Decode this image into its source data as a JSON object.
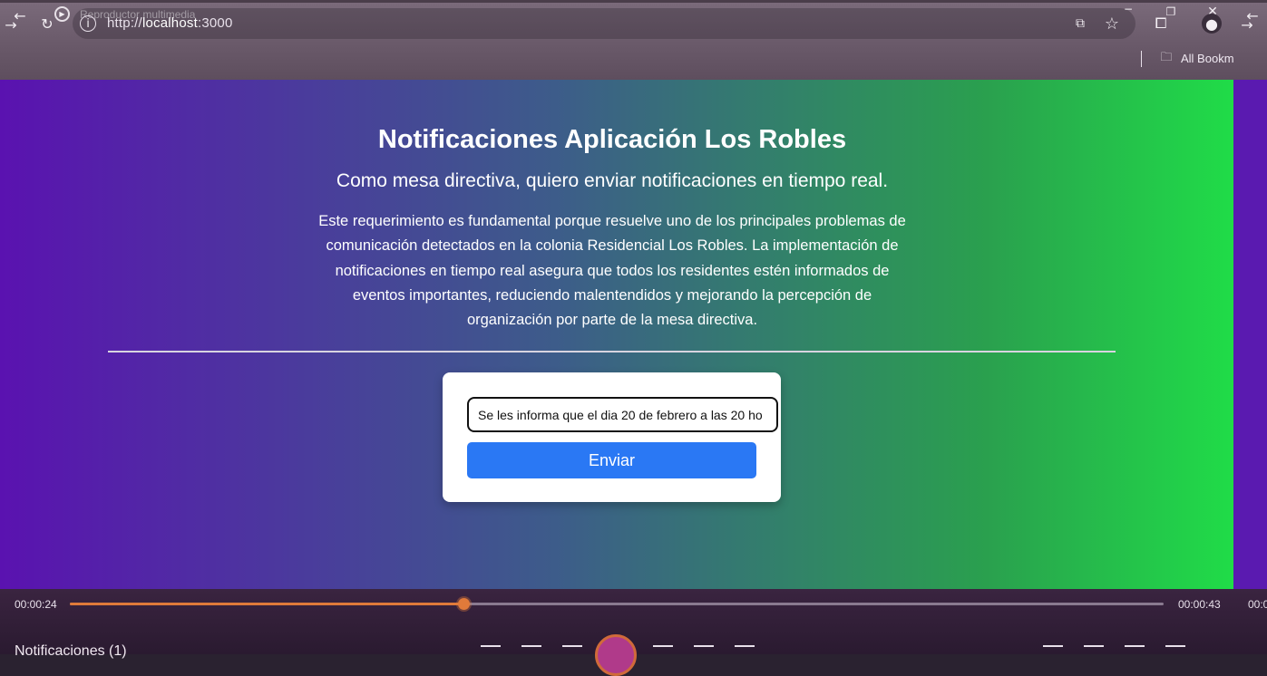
{
  "browser": {
    "player_title": "Reproductor multimedia",
    "url_scheme": "http://",
    "url_host": "localhost",
    "url_port": ":3000",
    "bookmarks_label": "All Bookm"
  },
  "page": {
    "title": "Notificaciones Aplicación Los Robles",
    "subtitle": "Como mesa directiva, quiero enviar notificaciones en tiempo real.",
    "description": "Este requerimiento es fundamental porque resuelve uno de los principales problemas de comunicación detectados en la colonia Residencial Los Robles. La implementación de notificaciones en tiempo real asegura que todos los residentes estén informados de eventos importantes, reduciendo malentendidos y mejorando la percepción de organización por parte de la mesa directiva."
  },
  "form": {
    "message_value": "Se les informa que el dia 20 de febrero a las 20 ho",
    "send_label": "Enviar"
  },
  "player": {
    "current_time": "00:00:24",
    "total_time": "00:00:43",
    "edge_time": "00:0",
    "progress_fraction": 0.36,
    "bottom_title": "Notificaciones (1)"
  },
  "colors": {
    "accent_button": "#2a78f4",
    "progress": "#e07a3a",
    "gradient_left": "#5a12b0",
    "gradient_right": "#20dc48"
  }
}
